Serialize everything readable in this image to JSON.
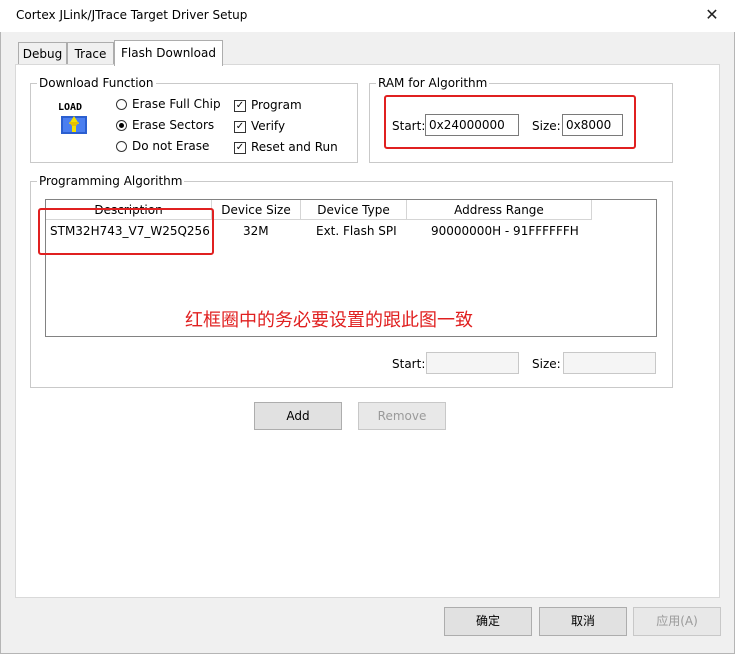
{
  "window": {
    "title": "Cortex JLink/JTrace Target Driver Setup",
    "close_glyph": "✕"
  },
  "tabs": [
    {
      "label": "Debug",
      "active": false
    },
    {
      "label": "Trace",
      "active": false
    },
    {
      "label": "Flash Download",
      "active": true
    }
  ],
  "download_function": {
    "legend": "Download Function",
    "icon_text": "LOAD",
    "options": [
      {
        "label": "Erase Full Chip",
        "selected": false
      },
      {
        "label": "Erase Sectors",
        "selected": true
      },
      {
        "label": "Do not Erase",
        "selected": false
      }
    ],
    "checks": [
      {
        "label": "Program",
        "checked": true
      },
      {
        "label": "Verify",
        "checked": true
      },
      {
        "label": "Reset and Run",
        "checked": true
      }
    ]
  },
  "ram": {
    "legend": "RAM for Algorithm",
    "start_label": "Start:",
    "start_value": "0x24000000",
    "size_label": "Size:",
    "size_value": "0x8000"
  },
  "programming": {
    "legend": "Programming Algorithm",
    "columns": [
      "Description",
      "Device Size",
      "Device Type",
      "Address Range"
    ],
    "rows": [
      {
        "description": "STM32H743_V7_W25Q256",
        "size": "32M",
        "type": "Ext. Flash SPI",
        "range": "90000000H - 91FFFFFFH"
      }
    ],
    "annotation": "红框圈中的务必要设置的跟此图一致",
    "start_label": "Start:",
    "start_value": "",
    "size_label": "Size:",
    "size_value": ""
  },
  "buttons": {
    "add": "Add",
    "remove": "Remove",
    "ok": "确定",
    "cancel": "取消",
    "apply": "应用(A)"
  },
  "colors": {
    "annotation": "#e02020"
  }
}
